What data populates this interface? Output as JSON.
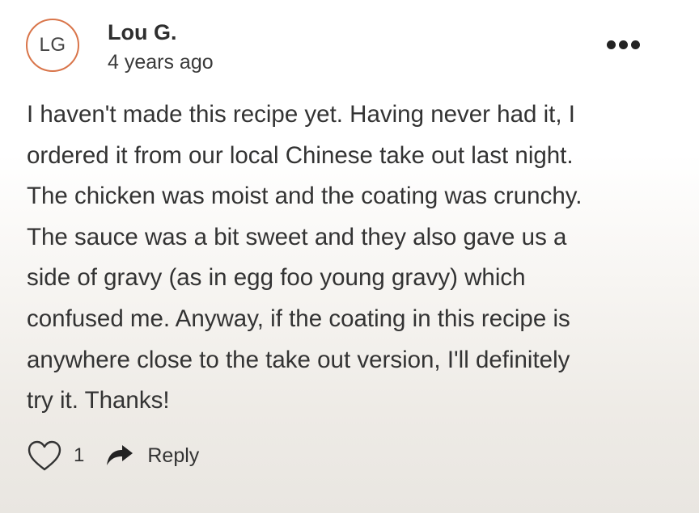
{
  "comment": {
    "avatar_initials": "LG",
    "author": "Lou G.",
    "timestamp": "4 years ago",
    "more_icon": "more-horizontal-icon",
    "body": "I haven't made this recipe yet. Having never had it, I\nordered it from our local Chinese take out last night.\nThe chicken was moist and the coating was crunchy.\nThe sauce was a bit sweet and they also gave us a\nside of gravy (as in egg foo young gravy) which\nconfused me. Anyway, if the coating in this recipe is\nanywhere close to the take out version, I'll definitely\ntry it. Thanks!",
    "like_icon": "heart-outline-icon",
    "like_count": "1",
    "reply_icon": "reply-arrow-icon",
    "reply_label": "Reply"
  },
  "colors": {
    "avatar_border": "#d9754a",
    "text": "#333333",
    "background_bottom": "#e9e6e1"
  }
}
